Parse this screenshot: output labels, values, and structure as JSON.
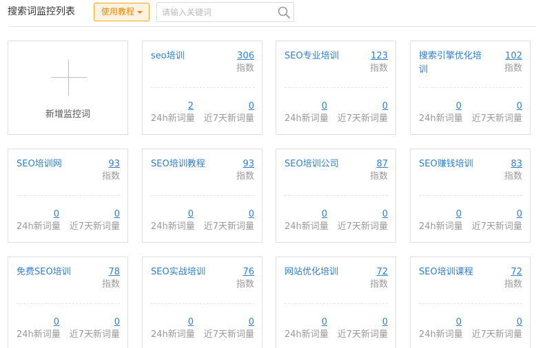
{
  "header": {
    "title": "搜索词监控列表",
    "tutorial_label": "使用教程",
    "search_placeholder": "请输入关键词"
  },
  "add_card": {
    "label": "新增监控词"
  },
  "labels": {
    "index": "指数",
    "new_24h": "24h新词量",
    "new_7d": "近7天新词量"
  },
  "keywords": [
    {
      "keyword": "seo培训",
      "index": "306",
      "new_24h": "2",
      "new_7d": "0"
    },
    {
      "keyword": "SEO专业培训",
      "index": "123",
      "new_24h": "0",
      "new_7d": "0"
    },
    {
      "keyword": "搜索引擎优化培训",
      "index": "102",
      "new_24h": "0",
      "new_7d": "0"
    },
    {
      "keyword": "SEO培训网",
      "index": "93",
      "new_24h": "0",
      "new_7d": "0"
    },
    {
      "keyword": "SEO培训教程",
      "index": "93",
      "new_24h": "0",
      "new_7d": "0"
    },
    {
      "keyword": "SEO培训公司",
      "index": "87",
      "new_24h": "0",
      "new_7d": "0"
    },
    {
      "keyword": "SEO赚钱培训",
      "index": "83",
      "new_24h": "0",
      "new_7d": "0"
    },
    {
      "keyword": "免费SEO培训",
      "index": "78",
      "new_24h": "0",
      "new_7d": "0"
    },
    {
      "keyword": "SEO实战培训",
      "index": "76",
      "new_24h": "0",
      "new_7d": "0"
    },
    {
      "keyword": "网站优化培训",
      "index": "72",
      "new_24h": "0",
      "new_7d": "0"
    },
    {
      "keyword": "SEO培训课程",
      "index": "72",
      "new_24h": "0",
      "new_7d": "0"
    }
  ],
  "colors": {
    "link": "#2f7dd1",
    "accent": "#f08300",
    "muted": "#999999"
  }
}
